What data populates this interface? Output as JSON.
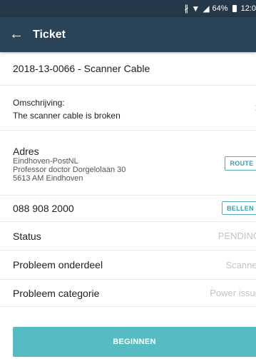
{
  "status_bar": {
    "icons": [
      "bluetooth-icon",
      "wifi-icon",
      "signal-icon"
    ],
    "battery": "64%",
    "time": "12:0"
  },
  "header": {
    "title": "Ticket",
    "back_icon": "arrow-left-icon"
  },
  "ticket": {
    "number_title": "2018-13-0066 - Scanner Cable",
    "description_label": "Omschrijving:",
    "description_value": "The scanner cable is broken",
    "address_label": "Adres",
    "address_lines": [
      "Eindhoven-PostNL",
      "Professor doctor Dorgelolaan 30",
      "5613 AM Eindhoven"
    ],
    "route_button": "ROUTE",
    "phone": "088 908 2000",
    "call_button": "BELLEN",
    "status_label": "Status",
    "status_value": "PENDING",
    "part_label": "Probleem onderdeel",
    "part_value": "Scanner",
    "category_label": "Probleem categorie",
    "category_value": "Power issue"
  },
  "action_button": "BEGINNEN",
  "colors": {
    "appbar": "#2c4459",
    "statusbar": "#24384a",
    "accent": "#3a9fb1",
    "primary_button": "#56bcc4"
  }
}
